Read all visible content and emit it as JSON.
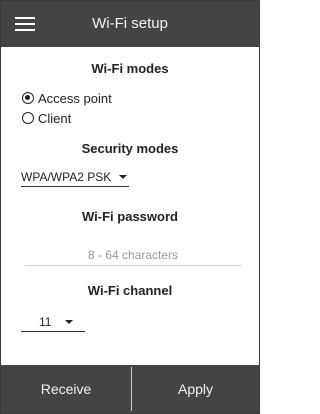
{
  "appbar": {
    "title": "Wi-Fi setup",
    "menu_icon": "hamburger-menu-icon"
  },
  "wifi_modes": {
    "title": "Wi-Fi modes",
    "options": [
      {
        "label": "Access point",
        "selected": true
      },
      {
        "label": "Client",
        "selected": false
      }
    ]
  },
  "security": {
    "title": "Security modes",
    "selected": "WPA/WPA2 PSK"
  },
  "password": {
    "title": "Wi-Fi password",
    "placeholder": "8 - 64 characters",
    "value": ""
  },
  "channel": {
    "title": "Wi-Fi channel",
    "selected": "11"
  },
  "actions": {
    "receive_label": "Receive",
    "apply_label": "Apply"
  },
  "colors": {
    "bar": "#444444",
    "text": "#222222",
    "placeholder": "#9a9a9a"
  }
}
